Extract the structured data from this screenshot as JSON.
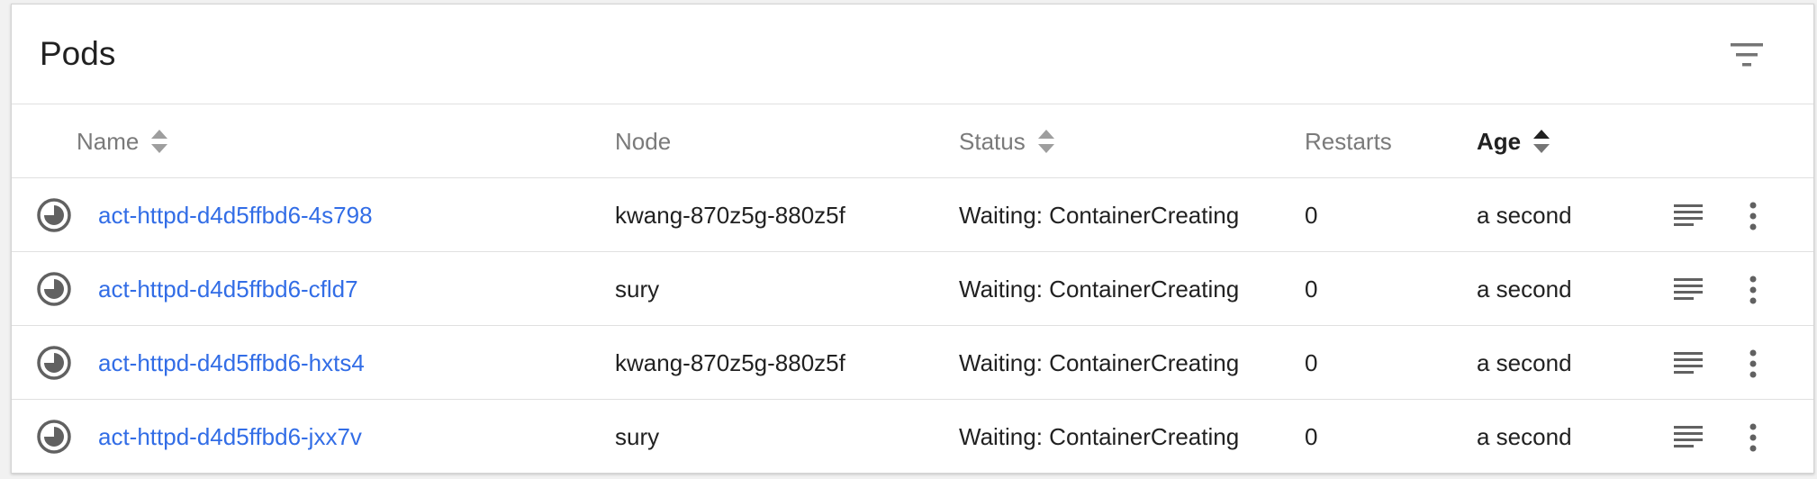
{
  "card": {
    "title": "Pods",
    "filter_icon": "filter-list-icon"
  },
  "columns": {
    "name": "Name",
    "node": "Node",
    "status": "Status",
    "restarts": "Restarts",
    "age": "Age",
    "sortable": [
      "Name",
      "Status",
      "Age"
    ],
    "active_sort": "Age"
  },
  "rows": [
    {
      "status_icon": "pending-clock-icon",
      "name": "act-httpd-d4d5ffbd6-4s798",
      "node": "kwang-870z5g-880z5f",
      "status": "Waiting: ContainerCreating",
      "restarts": "0",
      "age": "a second",
      "logs_icon": "logs-icon",
      "more_icon": "more-vert-icon"
    },
    {
      "status_icon": "pending-clock-icon",
      "name": "act-httpd-d4d5ffbd6-cfld7",
      "node": "sury",
      "status": "Waiting: ContainerCreating",
      "restarts": "0",
      "age": "a second",
      "logs_icon": "logs-icon",
      "more_icon": "more-vert-icon"
    },
    {
      "status_icon": "pending-clock-icon",
      "name": "act-httpd-d4d5ffbd6-hxts4",
      "node": "kwang-870z5g-880z5f",
      "status": "Waiting: ContainerCreating",
      "restarts": "0",
      "age": "a second",
      "logs_icon": "logs-icon",
      "more_icon": "more-vert-icon"
    },
    {
      "status_icon": "pending-clock-icon",
      "name": "act-httpd-d4d5ffbd6-jxx7v",
      "node": "sury",
      "status": "Waiting: ContainerCreating",
      "restarts": "0",
      "age": "a second",
      "logs_icon": "logs-icon",
      "more_icon": "more-vert-icon"
    }
  ],
  "colors": {
    "link": "#326de6",
    "header_text": "#7a7a7a",
    "text": "#212121",
    "icon": "#5f6368"
  }
}
